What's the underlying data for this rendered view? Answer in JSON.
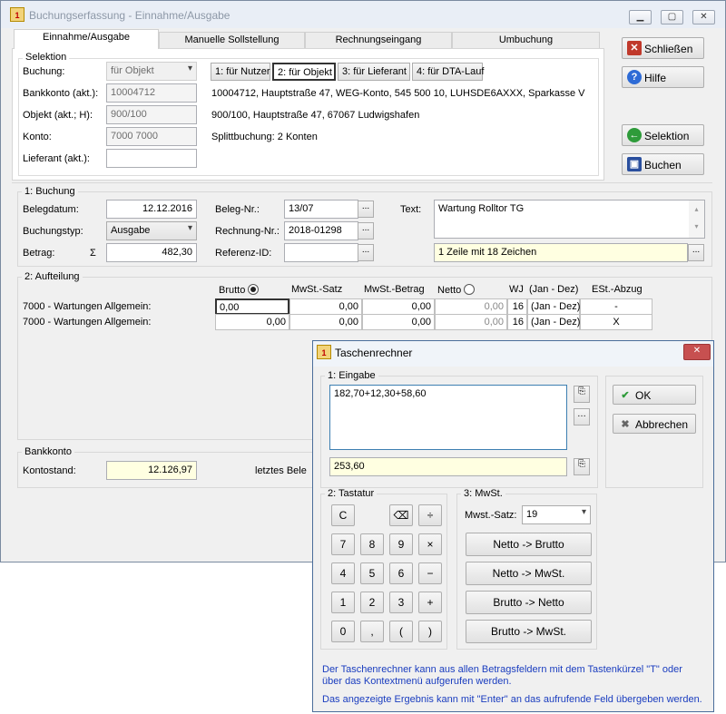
{
  "main_window": {
    "title": "Buchungserfassung - Einnahme/Ausgabe",
    "tabs": [
      "Einnahme/Ausgabe",
      "Manuelle Sollstellung",
      "Rechnungseingang",
      "Umbuchung"
    ],
    "selektion": {
      "title": "Selektion",
      "buchung_label": "Buchung:",
      "buchung_value": "für Objekt",
      "bankkonto_label": "Bankkonto (akt.):",
      "bankkonto_value": "10004712",
      "objekt_label": "Objekt (akt.; H):",
      "objekt_value": "900/100",
      "konto_label": "Konto:",
      "konto_value": "7000 7000",
      "lieferant_label": "Lieferant (akt.):",
      "lieferant_value": "",
      "seg_buttons": [
        "1: für Nutzer",
        "2: für Objekt",
        "3: für Lieferant",
        "4: für DTA-Lauf"
      ],
      "bank_info": "10004712,  Hauptstraße 47,  WEG-Konto,  545 500 10,  LUHSDE6AXXX,  Sparkasse V",
      "objekt_info": "900/100,  Hauptstraße 47, 67067 Ludwigshafen",
      "split_info": "Splittbuchung:  2 Konten"
    },
    "buchung": {
      "title": "1: Buchung",
      "belegdatum_label": "Belegdatum:",
      "belegdatum_value": "12.12.2016",
      "buchungstyp_label": "Buchungstyp:",
      "buchungstyp_value": "Ausgabe",
      "betrag_label": "Betrag:",
      "sigma": "Σ",
      "betrag_value": "482,30",
      "belegnr_label": "Beleg-Nr.:",
      "belegnr_value": "13/07",
      "rechnungnr_label": "Rechnung-Nr.:",
      "rechnungnr_value": "2018-01298",
      "referenz_label": "Referenz-ID:",
      "referenz_value": "",
      "text_label": "Text:",
      "text_value": "Wartung Rolltor TG",
      "text_info": "1 Zeile mit 18 Zeichen",
      "ellipsis": "..."
    },
    "aufteilung": {
      "title": "2: Aufteilung",
      "headers": {
        "brutto": "Brutto",
        "mwst_satz": "MwSt.-Satz",
        "mwst_betrag": "MwSt.-Betrag",
        "netto": "Netto",
        "wj": "WJ",
        "zeitraum": "(Jan - Dez)",
        "abzug": "ESt.-Abzug"
      },
      "rows": [
        {
          "konto": "7000 - Wartungen Allgemein:",
          "brutto": "0,00",
          "satz": "0,00",
          "betrag": "0,00",
          "netto": "0,00",
          "wj": "16",
          "zeitraum": "(Jan - Dez)",
          "abzug": "-"
        },
        {
          "konto": "7000 - Wartungen Allgemein:",
          "brutto": "0,00",
          "satz": "0,00",
          "betrag": "0,00",
          "netto": "0,00",
          "wj": "16",
          "zeitraum": "(Jan - Dez)",
          "abzug": "X"
        }
      ]
    },
    "bankkonto": {
      "title": "Bankkonto",
      "kontostand_label": "Kontostand:",
      "kontostand_value": "12.126,97",
      "letztes_label": "letztes Bele"
    },
    "side_buttons": {
      "schliessen": "Schließen",
      "hilfe": "Hilfe",
      "selektion": "Selektion",
      "buchen": "Buchen"
    }
  },
  "calculator": {
    "title": "Taschenrechner",
    "eingabe_title": "1: Eingabe",
    "eingabe_value": "182,70+12,30+58,60",
    "result_value": "253,60",
    "ok_label": "OK",
    "abbrechen_label": "Abbrechen",
    "tastatur_title": "2: Tastatur",
    "keys": [
      [
        "C",
        "",
        "⌫",
        "÷"
      ],
      [
        "7",
        "8",
        "9",
        "×"
      ],
      [
        "4",
        "5",
        "6",
        "−"
      ],
      [
        "1",
        "2",
        "3",
        "+"
      ],
      [
        "0",
        ",",
        "(",
        ")"
      ]
    ],
    "mwst_title": "3: MwSt.",
    "mwst_satz_label": "Mwst.-Satz:",
    "mwst_satz_value": "19",
    "conv_buttons": [
      "Netto -> Brutto",
      "Netto -> MwSt.",
      "Brutto -> Netto",
      "Brutto -> MwSt."
    ],
    "info1": "Der Taschenrechner kann aus allen Betragsfeldern mit dem Tastenkürzel \"T\" oder über das Kontextmenü aufgerufen werden.",
    "info2": "Das angezeigte Ergebnis kann mit \"Enter\" an das aufrufende Feld übergeben werden."
  },
  "colors": {
    "info_text": "#1a3dbf",
    "highlight_yellow": "#ffffe1",
    "focus_border": "#3c7fb1",
    "close_red": "#c75050"
  }
}
